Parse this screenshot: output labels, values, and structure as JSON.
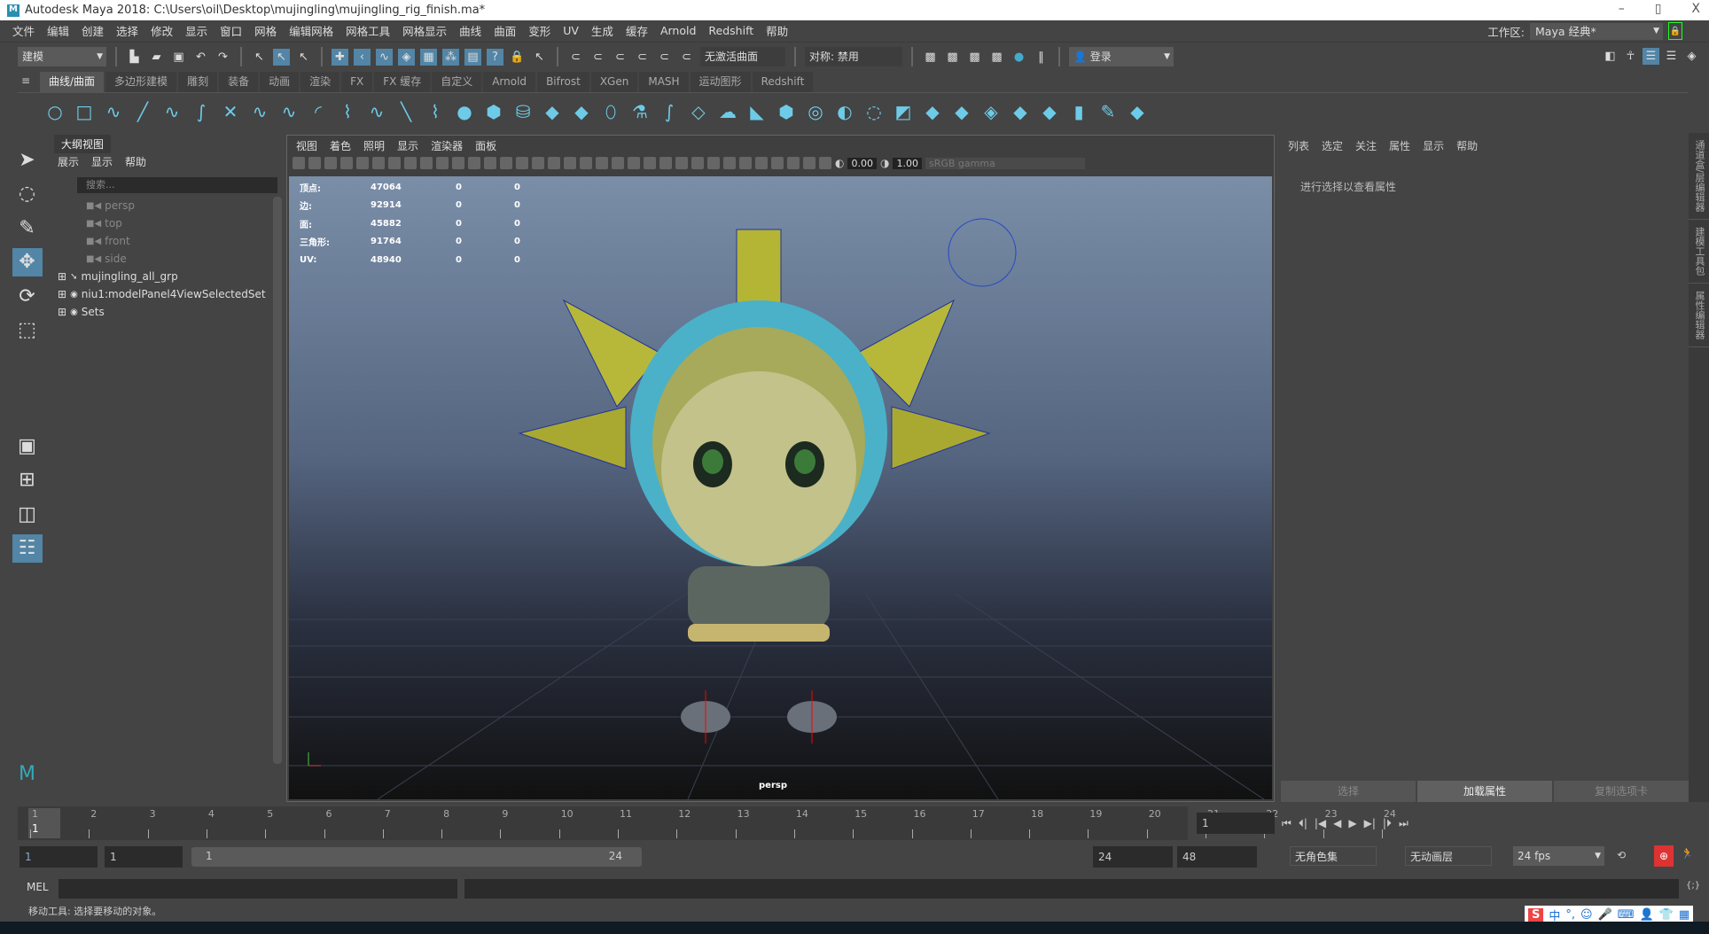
{
  "title": "Autodesk Maya 2018: C:\\Users\\oil\\Desktop\\mujingling\\mujingling_rig_finish.ma*",
  "window_controls": {
    "minimize": "–",
    "maximize": "▯",
    "close": "X"
  },
  "menu": [
    "文件",
    "编辑",
    "创建",
    "选择",
    "修改",
    "显示",
    "窗口",
    "网格",
    "编辑网格",
    "网格工具",
    "网格显示",
    "曲线",
    "曲面",
    "变形",
    "UV",
    "生成",
    "缓存",
    "Arnold",
    "Redshift",
    "帮助"
  ],
  "workspace": {
    "label": "工作区:",
    "value": "Maya 经典*"
  },
  "statusline": {
    "mode": "建模",
    "live_surface": "无激活曲面",
    "symmetry": "对称: 禁用",
    "login": "登录"
  },
  "shelf_tabs": [
    "曲线/曲面",
    "多边形建模",
    "雕刻",
    "装备",
    "动画",
    "渲染",
    "FX",
    "FX 缓存",
    "自定义",
    "Arnold",
    "Bifrost",
    "XGen",
    "MASH",
    "运动图形",
    "Redshift"
  ],
  "shelf_active": 0,
  "outliner": {
    "tab": "大纲视图",
    "menu": [
      "展示",
      "显示",
      "帮助"
    ],
    "search_placeholder": "搜索...",
    "items": [
      {
        "label": "persp",
        "type": "camera"
      },
      {
        "label": "top",
        "type": "camera"
      },
      {
        "label": "front",
        "type": "camera"
      },
      {
        "label": "side",
        "type": "camera"
      },
      {
        "label": "mujingling_all_grp",
        "type": "group"
      },
      {
        "label": "niu1:modelPanel4ViewSelectedSet",
        "type": "set"
      },
      {
        "label": "Sets",
        "type": "set"
      }
    ]
  },
  "viewport": {
    "menu": [
      "视图",
      "着色",
      "照明",
      "显示",
      "渲染器",
      "面板"
    ],
    "exposure": "0.00",
    "gamma": "1.00",
    "colorspace": "sRGB gamma",
    "camera": "persp",
    "hud": [
      {
        "label": "顶点:",
        "v": [
          "47064",
          "0",
          "0"
        ]
      },
      {
        "label": "边:",
        "v": [
          "92914",
          "0",
          "0"
        ]
      },
      {
        "label": "面:",
        "v": [
          "45882",
          "0",
          "0"
        ]
      },
      {
        "label": "三角形:",
        "v": [
          "91764",
          "0",
          "0"
        ]
      },
      {
        "label": "UV:",
        "v": [
          "48940",
          "0",
          "0"
        ]
      }
    ]
  },
  "attr_editor": {
    "menu": [
      "列表",
      "选定",
      "关注",
      "属性",
      "显示",
      "帮助"
    ],
    "hint": "进行选择以查看属性",
    "tabs": [
      "选择",
      "加载属性",
      "复制选项卡"
    ]
  },
  "side_tabs": [
    "通道盒/层编辑器",
    "建模工具包",
    "属性编辑器"
  ],
  "timeline": {
    "ticks": [
      "1",
      "2",
      "3",
      "4",
      "5",
      "6",
      "7",
      "8",
      "9",
      "10",
      "11",
      "12",
      "13",
      "14",
      "15",
      "16",
      "17",
      "18",
      "19",
      "20",
      "21",
      "22",
      "23",
      "24"
    ],
    "current": "1",
    "current_field": "1"
  },
  "range": {
    "start": "1",
    "anim_start": "1",
    "slider_start": "1",
    "slider_end": "24",
    "end": "24",
    "anim_end": "48",
    "char_set": "无角色集",
    "anim_layer": "无动画层",
    "fps": "24 fps"
  },
  "mel": {
    "label": "MEL"
  },
  "status": "移动工具: 选择要移动的对象。",
  "ime": {
    "lang": "中"
  },
  "colors": {
    "accent": "#5285a6",
    "shelf_icon": "#6ecbe8"
  }
}
